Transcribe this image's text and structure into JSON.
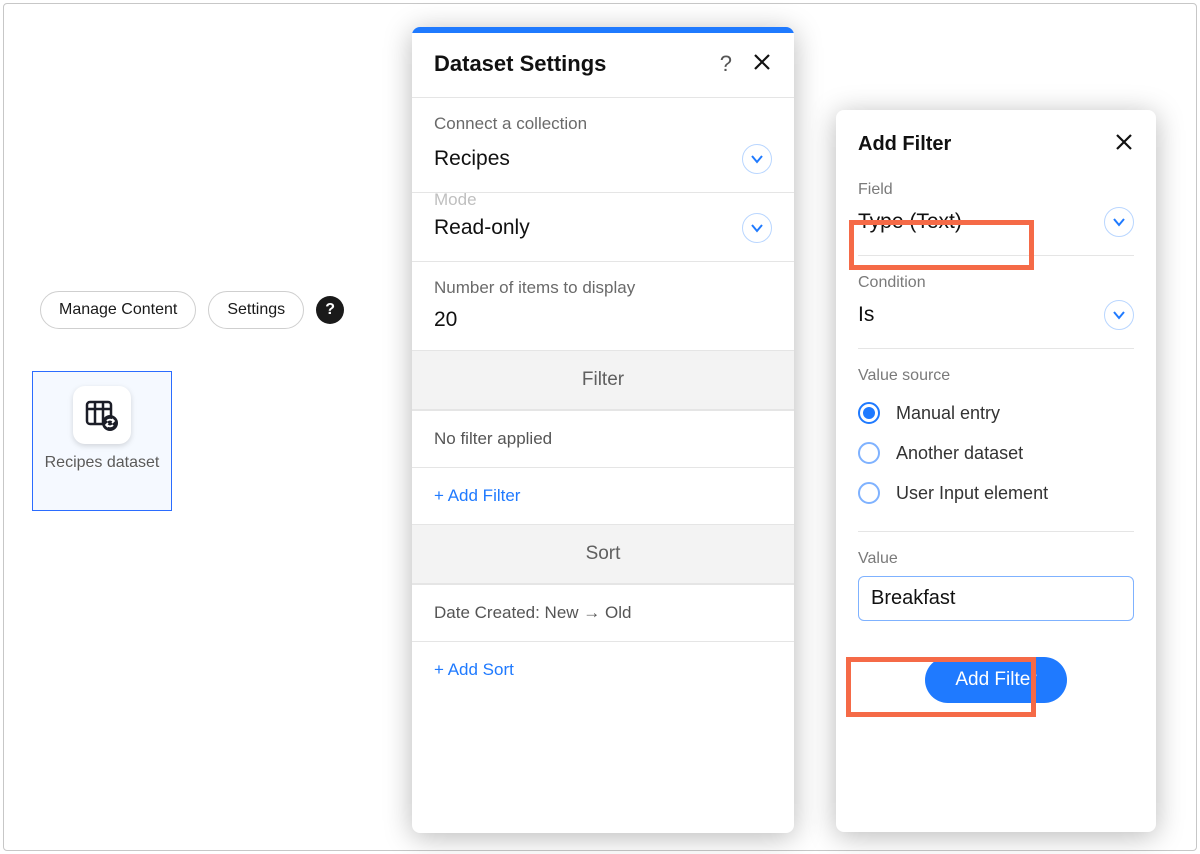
{
  "pills": {
    "manage": "Manage Content",
    "settings": "Settings"
  },
  "dataset_card": {
    "label": "Recipes dataset"
  },
  "settings_panel": {
    "title": "Dataset Settings",
    "connect_label": "Connect a collection",
    "connect_value": "Recipes",
    "mode_crop": "Mode",
    "mode_value": "Read-only",
    "num_label": "Number of items to display",
    "num_value": "20",
    "filter_header": "Filter",
    "no_filter": "No filter applied",
    "add_filter": "+ Add Filter",
    "sort_header": "Sort",
    "sort_row": "Date Created: New → Old",
    "add_sort": "+ Add Sort"
  },
  "filter_panel": {
    "title": "Add Filter",
    "field_label": "Field",
    "field_value": "Type (Text)",
    "condition_label": "Condition",
    "condition_value": "Is",
    "value_source_label": "Value source",
    "radios": {
      "manual": "Manual entry",
      "another": "Another dataset",
      "user": "User Input element"
    },
    "value_label": "Value",
    "value_input": "Breakfast",
    "button": "Add Filter"
  }
}
